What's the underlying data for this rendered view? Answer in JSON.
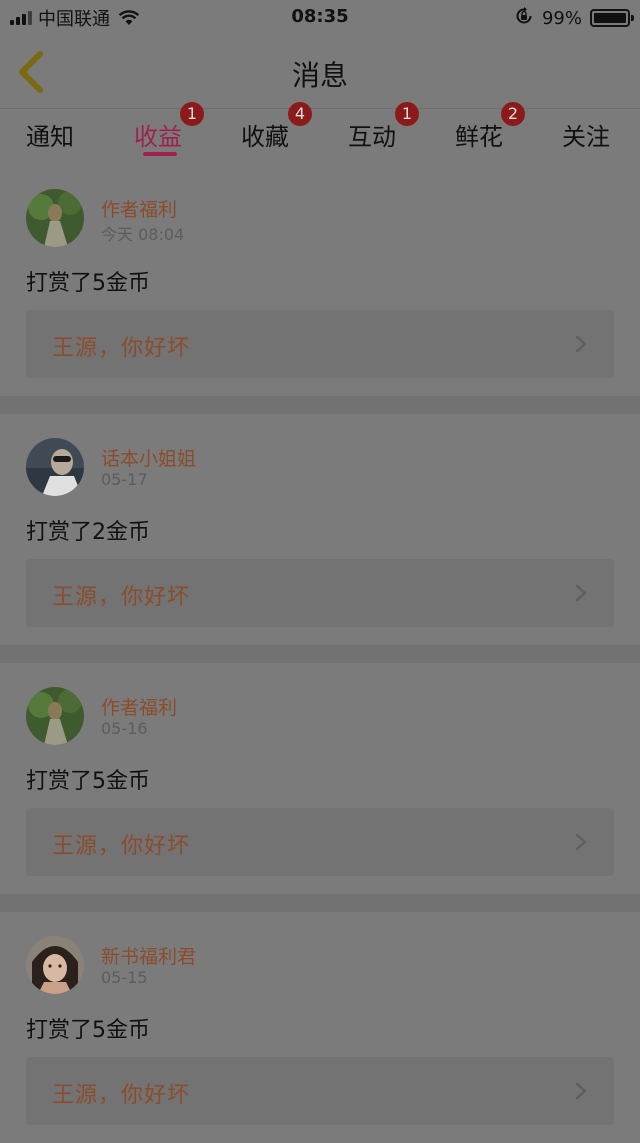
{
  "status_bar": {
    "carrier": "中国联通",
    "time": "08:35",
    "battery": "99%"
  },
  "nav": {
    "title": "消息",
    "back_icon": "chevron-left-icon"
  },
  "tabs": [
    {
      "label": "通知",
      "badge": ""
    },
    {
      "label": "收益",
      "badge": "1",
      "active": true
    },
    {
      "label": "收藏",
      "badge": "4"
    },
    {
      "label": "互动",
      "badge": "1"
    },
    {
      "label": "鲜花",
      "badge": "2"
    },
    {
      "label": "关注",
      "badge": ""
    }
  ],
  "messages": [
    {
      "sender": "作者福利",
      "date": "今天 08:04",
      "text": "打赏了5金币",
      "reply": "王源，你好坏"
    },
    {
      "sender": "话本小姐姐",
      "date": "05-17",
      "text": "打赏了2金币",
      "reply": "王源，你好坏"
    },
    {
      "sender": "作者福利",
      "date": "05-16",
      "text": "打赏了5金币",
      "reply": "王源，你好坏"
    },
    {
      "sender": "新书福利君",
      "date": "05-15",
      "text": "打赏了5金币",
      "reply": "王源，你好坏"
    }
  ],
  "colors": {
    "accent": "#a02050",
    "badge": "#8b1a1a",
    "sender": "#8b4c2c",
    "overlay_bg": "#7b7b7b"
  }
}
